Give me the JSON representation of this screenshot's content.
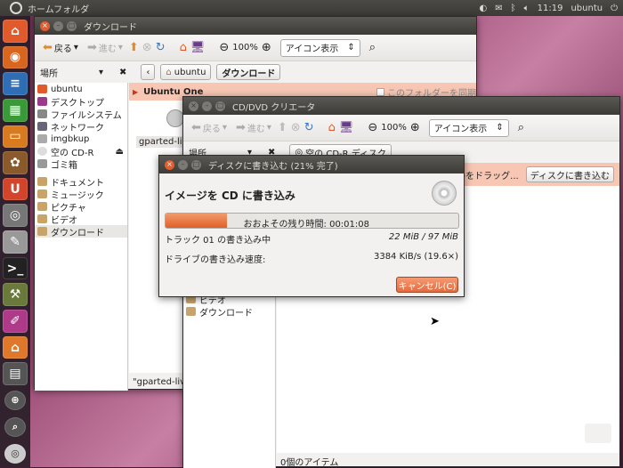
{
  "topbar": {
    "app_name": "ホームフォルダ",
    "time": "11:19",
    "user": "ubuntu",
    "icons": [
      "network-icon",
      "mail-icon",
      "bluetooth-icon",
      "volume-icon"
    ]
  },
  "launcher": {
    "items": [
      "home-folder-icon",
      "firefox-icon",
      "writer-icon",
      "calc-icon",
      "impress-icon",
      "software-center-icon",
      "ubuntu-one-icon",
      "camera-icon",
      "text-editor-icon",
      "terminal-icon",
      "tools-icon",
      "paint-icon",
      "home-folder-icon",
      "window-icon",
      "workspace-icon",
      "search-icon",
      "cd-icon"
    ]
  },
  "win1": {
    "title": "ダウンロード",
    "toolbar": {
      "back": "戻る",
      "forward": "進む",
      "zoom": "100%",
      "view": "アイコン表示"
    },
    "pathbar": {
      "places": "場所",
      "crumbs": [
        "ubuntu",
        "ダウンロード"
      ]
    },
    "sidebar": [
      "ubuntu",
      "デスクトップ",
      "ファイルシステム",
      "ネットワーク",
      "imgbkup",
      "空の CD-R",
      "ゴミ箱",
      "ドキュメント",
      "ミュージック",
      "ピクチャ",
      "ビデオ",
      "ダウンロード"
    ],
    "ubuntu_one": {
      "title": "Ubuntu One",
      "checkbox": "このフォルダーを同期"
    },
    "file_label": "gparted-live",
    "status": "\"gparted-live"
  },
  "win2": {
    "title": "CD/DVD クリエータ",
    "toolbar": {
      "back": "戻る",
      "forward": "進む",
      "zoom": "100%",
      "view": "アイコン表示"
    },
    "pathbar": {
      "places": "場所",
      "crumb": "空の CD-R ディスク"
    },
    "banner": {
      "text": "ァイルをドラッグ...",
      "button": "ディスクに書き込む"
    },
    "sidebar_tail": [
      "ビデオ",
      "ダウンロード"
    ],
    "status": "0個のアイテム"
  },
  "dialog": {
    "title": "ディスクに書き込む (21% 完了)",
    "heading": "イメージを CD に書き込み",
    "progress": 0.21,
    "remaining": "おおよその残り時間: 00:01:08",
    "track_label": "トラック 01 の書き込み中",
    "track_size": "22 MiB / 97 MiB",
    "speed_label": "ドライブの書き込み速度:",
    "speed_value": "3384 KiB/s (19.6×)",
    "cancel": "キャンセル(C)"
  }
}
